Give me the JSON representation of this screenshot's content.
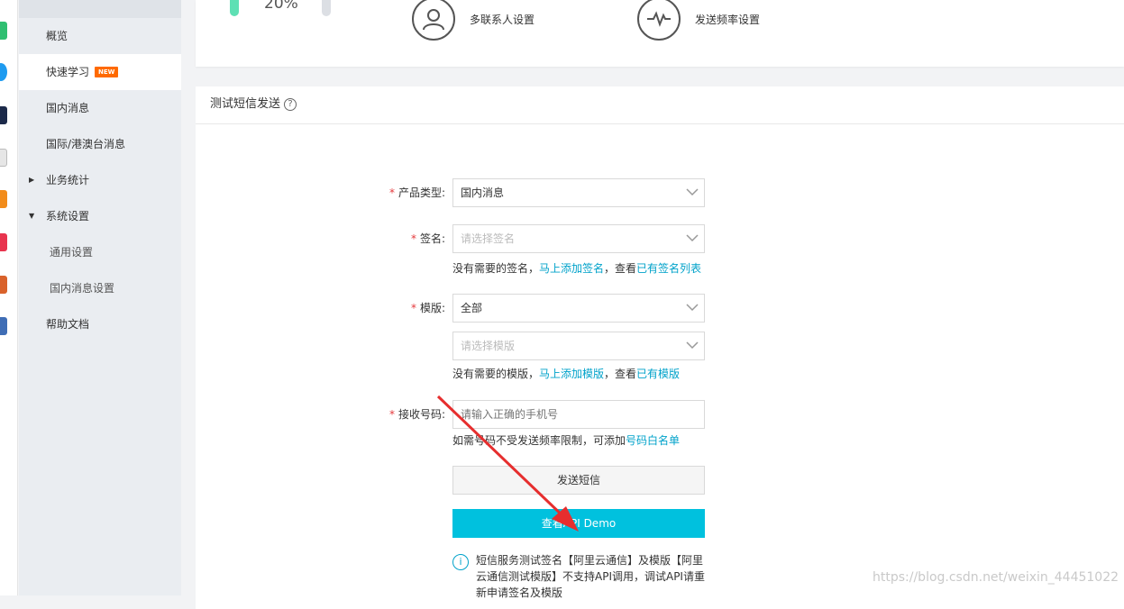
{
  "app_strip": {
    "icons": [
      {
        "name": "app-icon-green",
        "color": "#2fbf71"
      },
      {
        "name": "app-icon-blue",
        "color": "#1e9bf0"
      },
      {
        "name": "app-icon-dark",
        "color": "#1c2a4a"
      },
      {
        "name": "app-icon-gray",
        "color": "#d0d0d0"
      },
      {
        "name": "app-icon-orange",
        "color": "#f28c1b"
      },
      {
        "name": "app-icon-red",
        "color": "#e8344e"
      },
      {
        "name": "app-icon-game1",
        "color": "#d9622b"
      },
      {
        "name": "app-icon-game2",
        "color": "#3f6db5"
      }
    ]
  },
  "sidebar": {
    "items": [
      {
        "label": "概览"
      },
      {
        "label": "快速学习",
        "badge": "NEW"
      },
      {
        "label": "国内消息"
      },
      {
        "label": "国际/港澳台消息"
      },
      {
        "label": "业务统计"
      },
      {
        "label": "系统设置"
      },
      {
        "label": "通用设置"
      },
      {
        "label": "国内消息设置"
      },
      {
        "label": "帮助文档"
      }
    ]
  },
  "overview": {
    "gauge_percent": "20%",
    "shortcuts": [
      {
        "label": "多联系人设置",
        "icon": "user-icon"
      },
      {
        "label": "发送频率设置",
        "icon": "pulse-icon"
      }
    ]
  },
  "test_send": {
    "title": "测试短信发送",
    "help": "?",
    "product_type": {
      "label": "产品类型:",
      "value": "国内消息"
    },
    "signature": {
      "label": "签名:",
      "placeholder": "请选择签名",
      "hint_prefix": "没有需要的签名，",
      "hint_link1": "马上添加签名",
      "hint_mid": "，查看",
      "hint_link2": "已有签名列表"
    },
    "template": {
      "label": "模版:",
      "value": "全部",
      "placeholder": "请选择模版",
      "hint_prefix": "没有需要的模版，",
      "hint_link1": "马上添加模版",
      "hint_mid": "，查看",
      "hint_link2": "已有模版"
    },
    "phone": {
      "label": "接收号码:",
      "placeholder": "请输入正确的手机号",
      "hint_prefix": "如需号码不受发送频率限制，可添加",
      "hint_link": "号码白名单"
    },
    "send_button": "发送短信",
    "demo_button": "查看API Demo",
    "notice_icon": "i",
    "notice": "短信服务测试签名【阿里云通信】及模版【阿里云通信测试模版】不支持API调用，调试API请重新申请签名及模版"
  },
  "watermark": "https://blog.csdn.net/weixin_44451022",
  "colors": {
    "accent": "#00c1de",
    "link": "#00a2ca",
    "required": "#e4393c",
    "badge": "#ff6a00",
    "annotation_arrow": "#e62e2e"
  }
}
